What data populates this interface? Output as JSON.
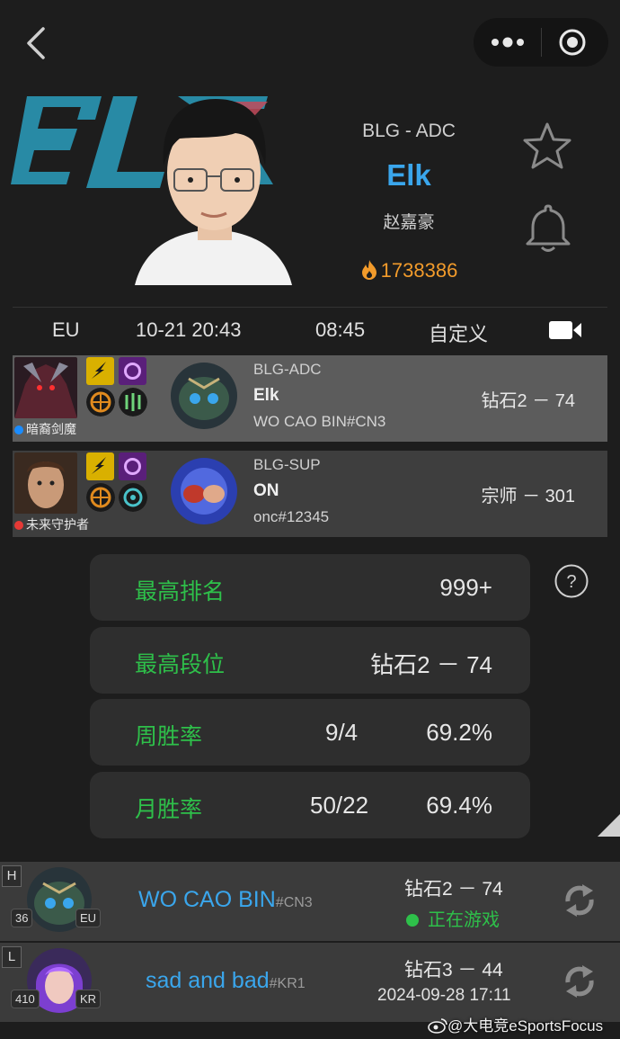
{
  "nav": {
    "back_icon": "chevron-left-icon",
    "more_icon": "more-dots-icon",
    "close_icon": "target-circle-icon"
  },
  "player": {
    "team_logo_text": "BLG",
    "team_role": "BLG - ADC",
    "name": "Elk",
    "real_name": "赵嘉豪",
    "heat": "1738386",
    "colors": {
      "name": "#3aa6ec",
      "heat": "#f29b2b",
      "logo": "#2a96b4"
    }
  },
  "info": {
    "region": "EU",
    "datetime": "10-21 20:43",
    "duration": "08:45",
    "mode": "自定义"
  },
  "match": [
    {
      "champion_name": "暗裔剑魔",
      "team_color": "#1a8cff",
      "team": "BLG-ADC",
      "name": "Elk",
      "tag": "WO CAO BIN#CN3",
      "rank": "钻石2 － 74"
    },
    {
      "champion_name": "未来守护者",
      "team_color": "#e53935",
      "team": "BLG-SUP",
      "name": "ON",
      "tag": "onc#12345",
      "rank": "宗师 － 301"
    }
  ],
  "stats": {
    "highest_rank_label": "最高排名",
    "highest_rank_value": "999+",
    "highest_tier_label": "最高段位",
    "highest_tier_value": "钻石2 － 74",
    "weekly_label": "周胜率",
    "weekly_record": "9/4",
    "weekly_rate": "69.2%",
    "monthly_label": "月胜率",
    "monthly_record": "50/22",
    "monthly_rate": "69.4%"
  },
  "accounts": [
    {
      "letter": "H",
      "level": "36",
      "region": "EU",
      "name": "WO CAO BIN",
      "tag": "#CN3",
      "rank": "钻石2 － 74",
      "status": "正在游戏"
    },
    {
      "letter": "L",
      "level": "410",
      "region": "KR",
      "name": "sad and bad",
      "tag": "#KR1",
      "rank": "钻石3 － 44",
      "last_played": "2024-09-28 17:11"
    }
  ],
  "watermark": "@大电竞eSportsFocus"
}
